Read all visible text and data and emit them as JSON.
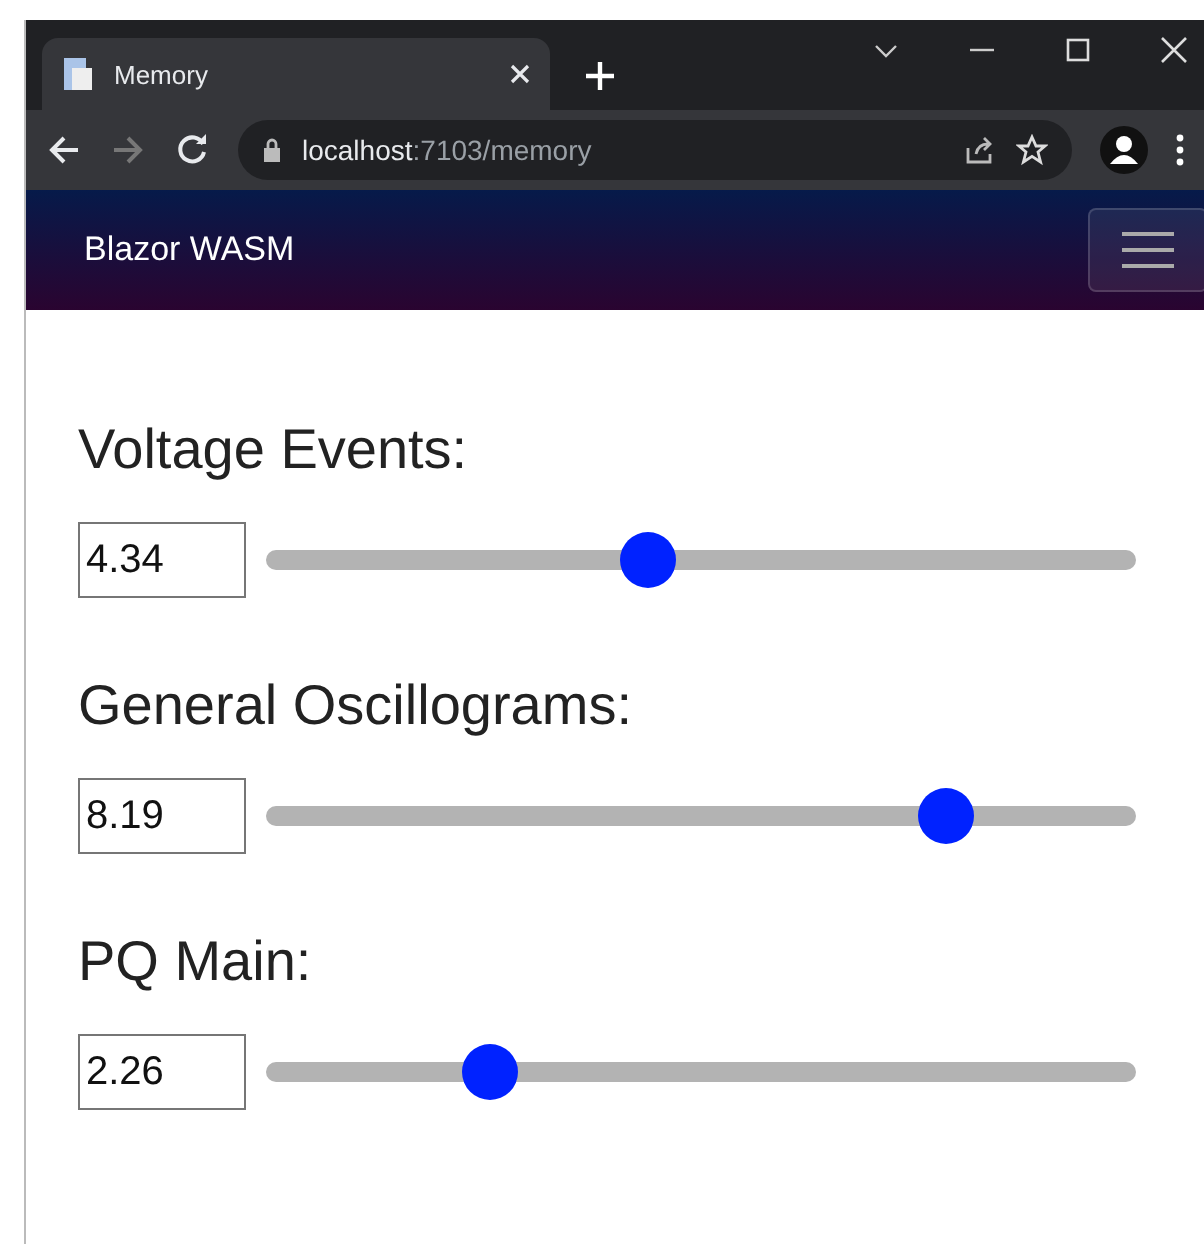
{
  "browser": {
    "tab_title": "Memory",
    "address_host": "localhost",
    "address_rest": ":7103/memory"
  },
  "navbar": {
    "brand": "Blazor WASM"
  },
  "sliders": [
    {
      "label": "Voltage Events:",
      "value": "4.34",
      "level": 0.436
    },
    {
      "label": "General Oscillograms:",
      "value": "8.19",
      "level": 0.8
    },
    {
      "label": "PQ Main:",
      "value": "2.26",
      "level": 0.24
    }
  ]
}
